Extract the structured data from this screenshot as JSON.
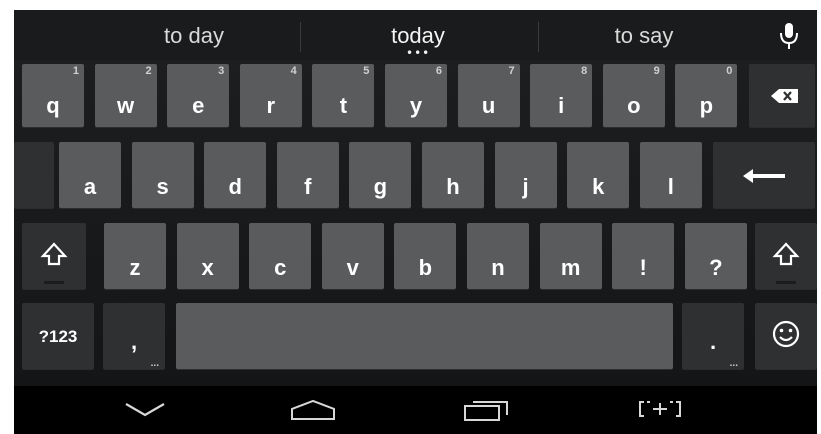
{
  "suggestions": {
    "left": "to day",
    "center": "today",
    "right": "to say",
    "center_more": "•••"
  },
  "icons": {
    "mic": "microphone-icon",
    "backspace": "backspace-icon",
    "enter": "enter-arrow-icon",
    "shift": "shift-arrow-icon",
    "emoji": "smiley-icon",
    "back": "nav-back-icon",
    "home": "nav-home-icon",
    "recents": "nav-recents-icon",
    "keyboard_switch": "keyboard-switch-icon"
  },
  "keyboard": {
    "row1": [
      {
        "label": "q",
        "hint": "1"
      },
      {
        "label": "w",
        "hint": "2"
      },
      {
        "label": "e",
        "hint": "3"
      },
      {
        "label": "r",
        "hint": "4"
      },
      {
        "label": "t",
        "hint": "5"
      },
      {
        "label": "y",
        "hint": "6"
      },
      {
        "label": "u",
        "hint": "7"
      },
      {
        "label": "i",
        "hint": "8"
      },
      {
        "label": "o",
        "hint": "9"
      },
      {
        "label": "p",
        "hint": "0"
      }
    ],
    "row2": [
      "a",
      "s",
      "d",
      "f",
      "g",
      "h",
      "j",
      "k",
      "l"
    ],
    "row3": [
      "z",
      "x",
      "c",
      "v",
      "b",
      "n",
      "m",
      "!",
      "?"
    ],
    "row4": {
      "symbols": "?123",
      "comma": ",",
      "period": ".",
      "comma_more": "...",
      "period_more": "..."
    }
  },
  "colors": {
    "key": "#5a5b5d",
    "key_dark": "#2f3031",
    "background": "#161718",
    "text": "#ffffff"
  }
}
